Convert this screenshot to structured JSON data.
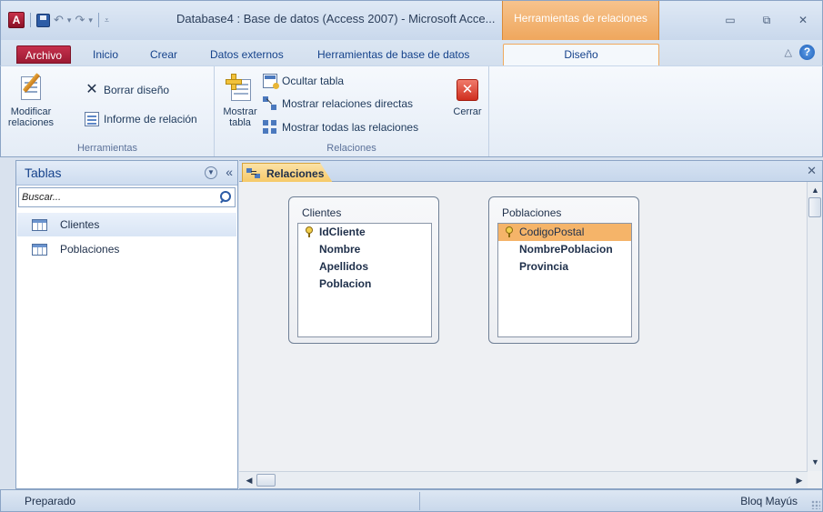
{
  "title_bar": {
    "app_icon_letter": "A",
    "title": "Database4 : Base de datos (Access 2007)  -  Microsoft Acce...",
    "context_tab_group": "Herramientas de relaciones"
  },
  "ribbon_tabs": [
    "Archivo",
    "Inicio",
    "Crear",
    "Datos externos",
    "Herramientas de base de datos",
    "Diseño"
  ],
  "ribbon": {
    "groups": [
      {
        "label": "Herramientas",
        "modify_btn": [
          "Modificar",
          "relaciones"
        ],
        "clear_layout": "Borrar diseño",
        "relation_report": "Informe de relación"
      },
      {
        "label": "Relaciones",
        "show_table_btn": [
          "Mostrar",
          "tabla"
        ],
        "hide_table": "Ocultar tabla",
        "direct_relations": "Mostrar relaciones directas",
        "all_relations": "Mostrar todas las relaciones",
        "close_btn": "Cerrar"
      }
    ]
  },
  "nav_pane": {
    "title": "Tablas",
    "search_placeholder": "Buscar...",
    "items": [
      {
        "label": "Clientes",
        "icon": "table-icon"
      },
      {
        "label": "Poblaciones",
        "icon": "table-icon"
      }
    ]
  },
  "document": {
    "tab_label": "Relaciones",
    "tables": [
      {
        "name": "Clientes",
        "fields": [
          {
            "name": "IdCliente",
            "key": true
          },
          {
            "name": "Nombre",
            "key": false
          },
          {
            "name": "Apellidos",
            "key": false
          },
          {
            "name": "Poblacion",
            "key": false
          }
        ]
      },
      {
        "name": "Poblaciones",
        "fields": [
          {
            "name": "CodigoPostal",
            "key": true,
            "selected": true
          },
          {
            "name": "NombrePoblacion",
            "key": false
          },
          {
            "name": "Provincia",
            "key": false
          }
        ]
      }
    ]
  },
  "status_bar": {
    "left": "Preparado",
    "right": "Bloq Mayús"
  },
  "colors": {
    "file_tab": "#c5304c",
    "context_tab": "#efa65c",
    "selected_field": "#f5b469",
    "doc_tab": "#f6c865"
  }
}
